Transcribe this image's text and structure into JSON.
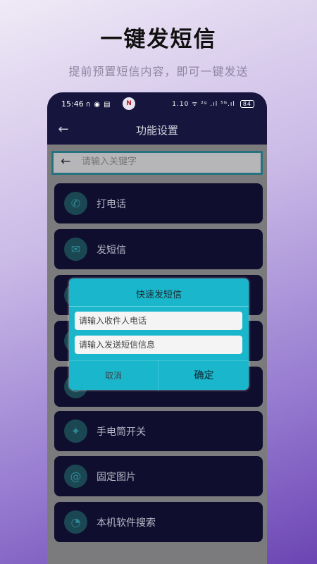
{
  "promo": {
    "title": "一键发短信",
    "subtitle": "提前预置短信内容，即可一键发送"
  },
  "status_bar": {
    "time": "15:46",
    "left_icons": "ก ◉ ▤",
    "app_icon": "N",
    "right_icons": "1.10 ᯤ ²ᵍ .ıl ⁵ᴳ.ıl",
    "battery": "84"
  },
  "header": {
    "back_glyph": "←",
    "title": "功能设置"
  },
  "search": {
    "back_glyph": "←",
    "placeholder": "请输入关键字"
  },
  "items": [
    {
      "label": "打电话",
      "icon": "phone-icon",
      "glyph": "✆"
    },
    {
      "label": "发短信",
      "icon": "message-icon",
      "glyph": "✉"
    },
    {
      "label": "",
      "icon": "hidden-icon",
      "glyph": "◎"
    },
    {
      "label": "",
      "icon": "hidden-icon",
      "glyph": "◎"
    },
    {
      "label": "",
      "icon": "hidden-icon",
      "glyph": "◎"
    },
    {
      "label": "手电筒开关",
      "icon": "flashlight-icon",
      "glyph": "✦"
    },
    {
      "label": "固定图片",
      "icon": "image-icon",
      "glyph": "@"
    },
    {
      "label": "本机软件搜索",
      "icon": "search-app-icon",
      "glyph": "◔"
    }
  ],
  "dialog": {
    "title": "快速发短信",
    "recipient_placeholder": "请输入收件人电话",
    "message_placeholder": "请输入发送短信信息",
    "cancel_label": "取消",
    "ok_label": "确定"
  },
  "colors": {
    "phone_bg": "#16153d",
    "list_item_bg": "#0f0e2e",
    "dialog_bg": "#19b6cc",
    "accent_teal": "#26737f"
  }
}
